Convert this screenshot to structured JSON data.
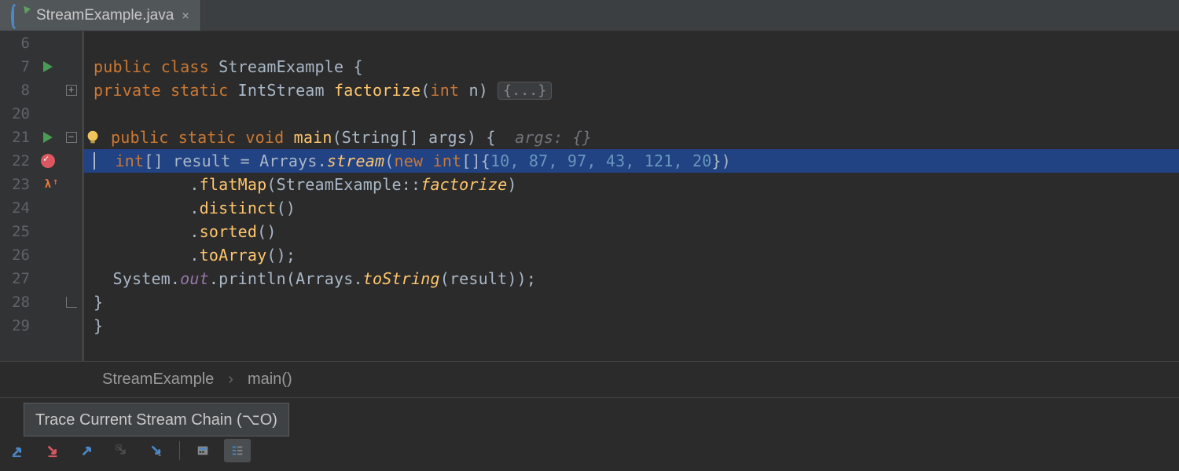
{
  "tab": {
    "filename": "StreamExample.java",
    "close_glyph": "×"
  },
  "lines": [
    {
      "n": 6
    },
    {
      "n": 7,
      "run": true
    },
    {
      "n": 8,
      "fold": "+"
    },
    {
      "n": 20
    },
    {
      "n": 21,
      "run": true,
      "fold": "−",
      "bulb": true
    },
    {
      "n": 22,
      "bp": true,
      "current": true
    },
    {
      "n": 23,
      "lambda": true
    },
    {
      "n": 24
    },
    {
      "n": 25
    },
    {
      "n": 26
    },
    {
      "n": 27
    },
    {
      "n": 28,
      "fold": "⌐"
    },
    {
      "n": 29
    }
  ],
  "code": {
    "l7": {
      "kw1": "public ",
      "kw2": "class ",
      "name": "StreamExample ",
      "brace": "{"
    },
    "l8": {
      "kw1": "private ",
      "kw2": "static ",
      "type": "IntStream ",
      "mth": "factorize",
      "sig": "(",
      "ptype": "int ",
      "pname": "n",
      "close": ") ",
      "folded": "{...}"
    },
    "l21": {
      "kw1": "public ",
      "kw2": "static ",
      "kw3": "void ",
      "mth": "main",
      "sig": "(String[] args) {  ",
      "hint": "args: {}"
    },
    "l22": {
      "pre": "  ",
      "type": "int",
      "arr": "[] ",
      "var": "result = Arrays.",
      "sm": "stream",
      "open": "(",
      "kw": "new int",
      "arr2": "[]{",
      "nums": "10, 87, 97, 43, 121, 20",
      "close": "})"
    },
    "l23": {
      "pre": "          .",
      "mth": "flatMap",
      "open": "(StreamExample::",
      "sm": "factorize",
      "close": ")"
    },
    "l24": {
      "pre": "          .",
      "mth": "distinct",
      "close": "()"
    },
    "l25": {
      "pre": "          .",
      "mth": "sorted",
      "close": "()"
    },
    "l26": {
      "pre": "          .",
      "mth": "toArray",
      "close": "();"
    },
    "l27": {
      "pre": "  System.",
      "fld": "out",
      "mid": ".println(Arrays.",
      "sm": "toString",
      "close": "(result));"
    },
    "l28": {
      "brace": "}"
    },
    "l29": {
      "brace": "}"
    }
  },
  "breadcrumb": {
    "class": "StreamExample",
    "sep": "›",
    "method": "main()"
  },
  "tooltip": "Trace Current Stream Chain (⌥O)",
  "colors": {
    "bg": "#2b2b2b",
    "gutter": "#313335",
    "sel": "#214283"
  }
}
